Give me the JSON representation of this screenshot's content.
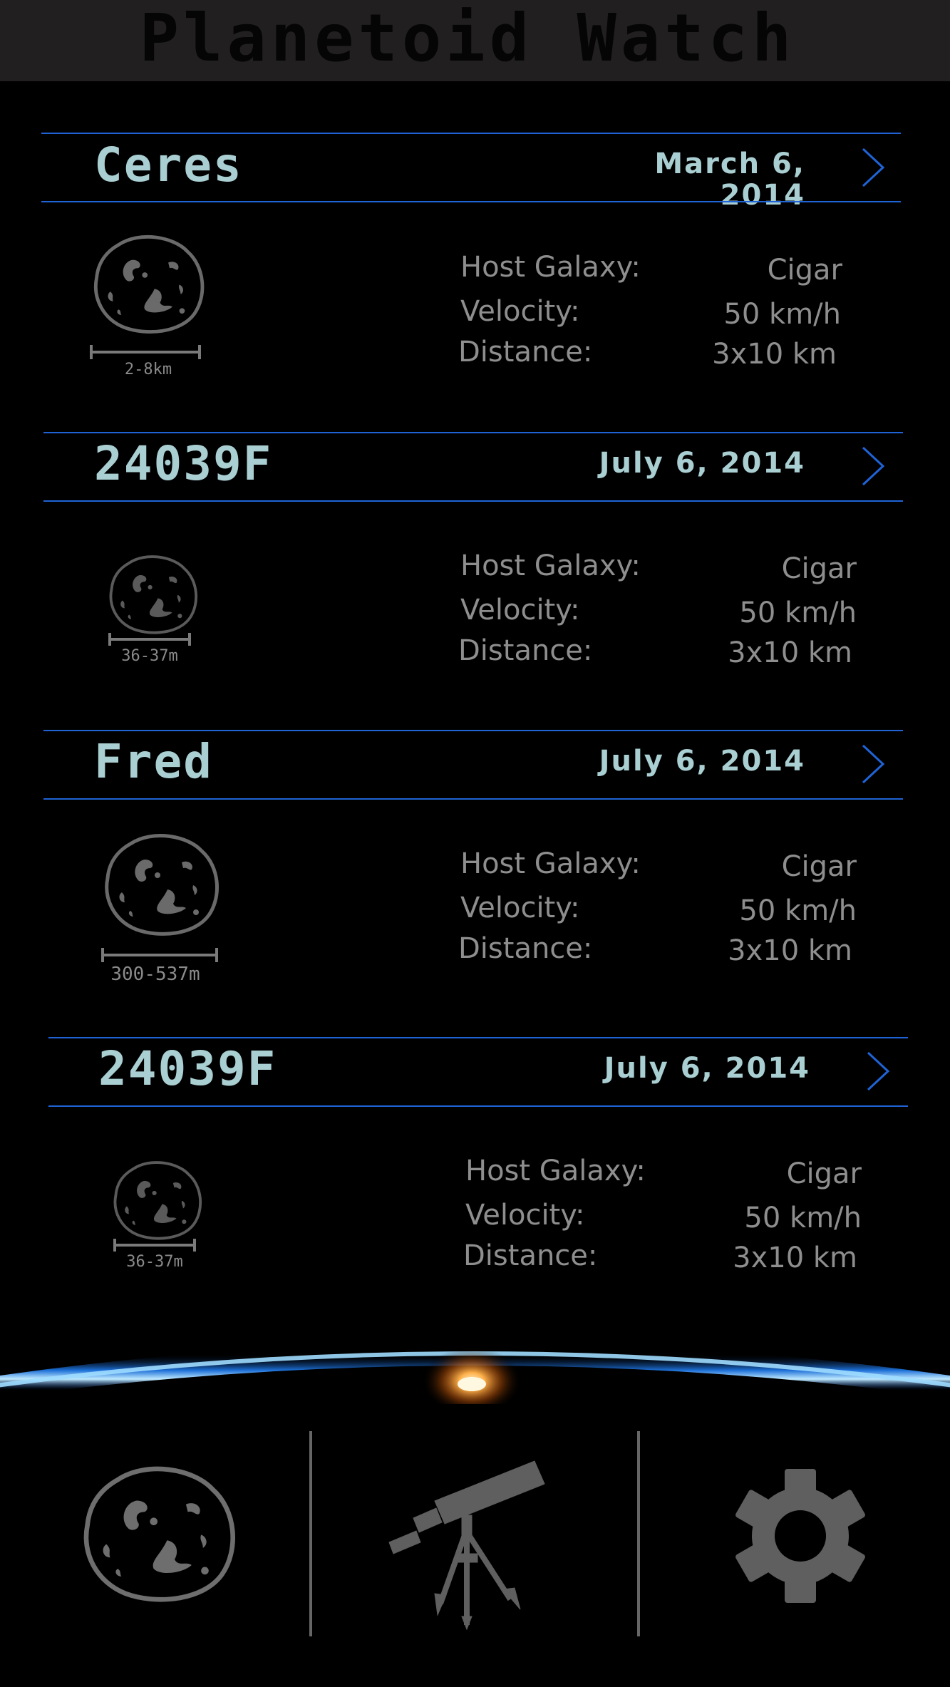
{
  "header": {
    "title": "Planetoid Watch"
  },
  "entries": [
    {
      "name": "Ceres",
      "date": "March 6, 2014",
      "size": "2-8km",
      "host_label": "Host Galaxy:",
      "host": "Cigar",
      "velocity_label": "Velocity:",
      "velocity": "50 km/h",
      "distance_label": "Distance:",
      "distance": "3x10 km"
    },
    {
      "name": "24039F",
      "date": "July 6, 2014",
      "size": "36-37m",
      "host_label": "Host Galaxy:",
      "host": "Cigar",
      "velocity_label": "Velocity:",
      "velocity": "50 km/h",
      "distance_label": "Distance:",
      "distance": "3x10 km"
    },
    {
      "name": "Fred",
      "date": "July 6, 2014",
      "size": "300-537m",
      "host_label": "Host Galaxy:",
      "host": "Cigar",
      "velocity_label": "Velocity:",
      "velocity": "50 km/h",
      "distance_label": "Distance:",
      "distance": "3x10 km"
    },
    {
      "name": "24039F",
      "date": "July 6, 2014",
      "size": "36-37m",
      "host_label": "Host Galaxy:",
      "host": "Cigar",
      "velocity_label": "Velocity:",
      "velocity": "50 km/h",
      "distance_label": "Distance:",
      "distance": "3x10 km"
    }
  ],
  "bottom_nav": {
    "items": [
      {
        "icon": "asteroid-icon"
      },
      {
        "icon": "telescope-icon"
      },
      {
        "icon": "gear-icon"
      }
    ]
  },
  "colors": {
    "accent_line": "#1f63d6",
    "title_text": "#a9cfd2",
    "detail_text": "#8e8e8e",
    "header_bg": "#211f20"
  }
}
